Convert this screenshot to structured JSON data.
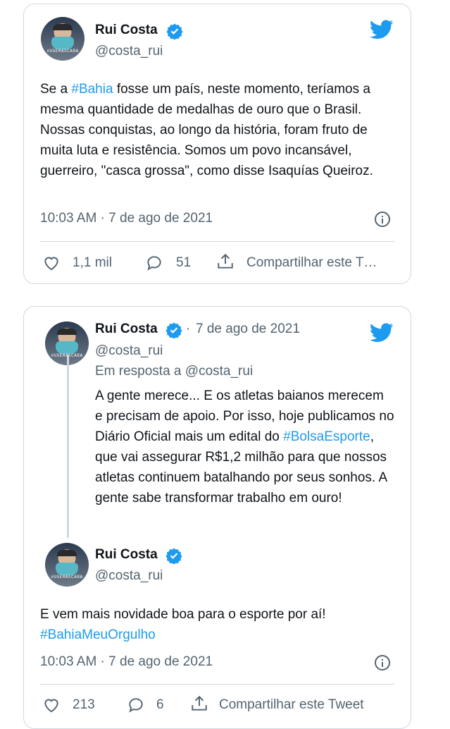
{
  "tweet1": {
    "name": "Rui Costa",
    "handle": "@costa_rui",
    "text_parts": [
      "Se a ",
      "#Bahia",
      " fosse um país, neste momento, teríamos a mesma quantidade de medalhas de ouro que o Brasil. Nossas conquistas, ao longo da história, foram fruto de muita luta e resistência. Somos um povo incansável, guerreiro, \"casca grossa\", como disse Isaquías Queiroz."
    ],
    "timestamp": "10:03 AM · 7 de ago de 2021",
    "likes": "1,1 mil",
    "replies": "51",
    "share_label": "Compartilhar este T…",
    "avatar_tag": "#USEMÁSCARA"
  },
  "tweet2": {
    "name": "Rui Costa",
    "dot": "·",
    "date": "7 de ago de 2021",
    "handle": "@costa_rui",
    "reply_to": "Em resposta a @costa_rui",
    "text_parts": [
      "A gente merece... E os atletas baianos merecem e precisam de apoio. Por isso, hoje publicamos no Diário Oficial mais um edital do ",
      "#BolsaEsporte",
      ", que vai assegurar R$1,2 milhão para que nossos atletas continuem batalhando por seus sonhos. A gente sabe transformar trabalho em ouro!"
    ],
    "avatar_tag": "#USEMÁSCARA"
  },
  "tweet3": {
    "name": "Rui Costa",
    "handle": "@costa_rui",
    "text": "E vem mais novidade boa para o esporte por aí!",
    "hashtag": "#BahiaMeuOrgulho",
    "timestamp": "10:03 AM · 7 de ago de 2021",
    "likes": "213",
    "replies": "6",
    "share_label": "Compartilhar este Tweet",
    "avatar_tag": "#USEMÁSCARA"
  },
  "colors": {
    "link": "#1d9bf0",
    "verified": "#1d9bf0",
    "secondary_text": "#536471"
  }
}
